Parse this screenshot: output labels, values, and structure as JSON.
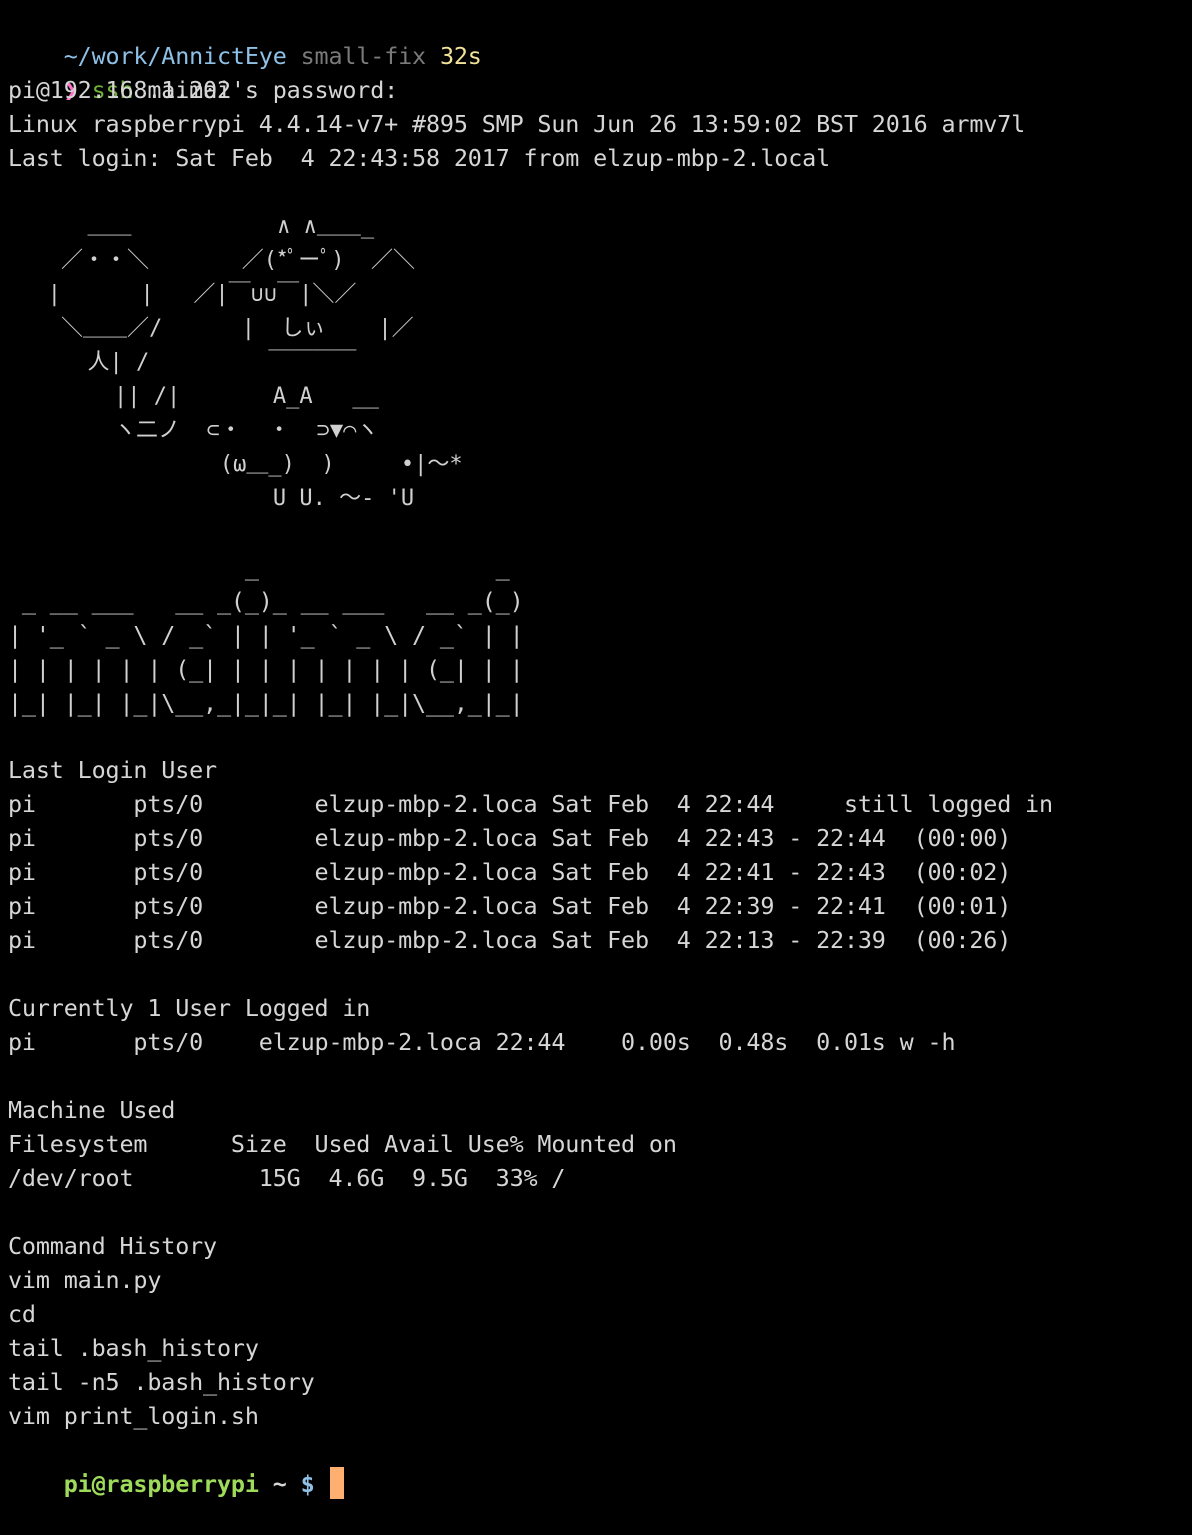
{
  "prompt_header": {
    "path": "~/work/AnnictEye",
    "branch": "small-fix",
    "duration": "32s"
  },
  "command": {
    "arrow": "❯",
    "program": "ssh",
    "argument": "maimai"
  },
  "ssh_output": {
    "password_prompt": "pi@192.168.1.202's password:",
    "uname": "Linux raspberrypi 4.4.14-v7+ #895 SMP Sun Jun 26 13:59:02 BST 2016 armv7l",
    "last_login": "Last login: Sat Feb  4 22:43:58 2017 from elzup-mbp-2.local"
  },
  "kaomoji_art": [
    "      ＿＿           ∧ ∧＿＿_",
    "    ／・・＼       ／(*ﾟーﾟ)  ／＼",
    "   |      |   ／|￣∪∪￣|＼／",
    "    ＼＿＿／/      |  しぃ    |／",
    "      人| /         ￣￣￣￣",
    "        || /|       A_A   __",
    "        ヽ二ノ  ⊂・  ・  ⊃▼⌒ヽ",
    "                (ω＿_)  )     •|～*",
    "                    U U. ～- 'U"
  ],
  "banner_art": [
    "                 _                 _",
    " _ __ ___   __ _(_)_ __ ___   __ _(_)",
    "| '_ ` _ \\ / _` | | '_ ` _ \\ / _` | |",
    "| | | | | | (_| | | | | | | | (_| | |",
    "|_| |_| |_|\\__,_|_|_| |_| |_|\\__,_|_|"
  ],
  "last_login_section": {
    "title": "Last Login User",
    "rows": [
      {
        "user": "pi",
        "tty": "pts/0",
        "host": "elzup-mbp-2.loca",
        "date": "Sat Feb  4",
        "time": "22:44  ",
        "status": " still logged in"
      },
      {
        "user": "pi",
        "tty": "pts/0",
        "host": "elzup-mbp-2.loca",
        "date": "Sat Feb  4",
        "time": "22:43 - 22:44",
        "status": "(00:00)"
      },
      {
        "user": "pi",
        "tty": "pts/0",
        "host": "elzup-mbp-2.loca",
        "date": "Sat Feb  4",
        "time": "22:41 - 22:43",
        "status": "(00:02)"
      },
      {
        "user": "pi",
        "tty": "pts/0",
        "host": "elzup-mbp-2.loca",
        "date": "Sat Feb  4",
        "time": "22:39 - 22:41",
        "status": "(00:01)"
      },
      {
        "user": "pi",
        "tty": "pts/0",
        "host": "elzup-mbp-2.loca",
        "date": "Sat Feb  4",
        "time": "22:13 - 22:39",
        "status": "(00:26)"
      }
    ]
  },
  "current_users_section": {
    "title": "Currently 1 User Logged in",
    "rows": [
      {
        "user": "pi",
        "tty": "pts/0",
        "from": "elzup-mbp-2.loca",
        "login": "22:44",
        "idle": "0.00s",
        "jcpu": "0.48s",
        "pcpu": "0.01s",
        "what": "w -h"
      }
    ]
  },
  "machine_section": {
    "title": "Machine Used",
    "headers": [
      "Filesystem",
      "Size",
      "Used",
      "Avail",
      "Use%",
      "Mounted on"
    ],
    "rows": [
      {
        "filesystem": "/dev/root",
        "size": "15G",
        "used": "4.6G",
        "avail": "9.5G",
        "use_pct": "33%",
        "mounted": "/"
      }
    ]
  },
  "history_section": {
    "title": "Command History",
    "commands": [
      "vim main.py",
      "cd",
      "tail .bash_history",
      "tail -n5 .bash_history",
      "vim print_login.sh"
    ]
  },
  "shell_prompt": {
    "user_host": "pi@raspberrypi",
    "cwd": "~",
    "symbol": "$"
  },
  "colors": {
    "background": "#000000",
    "foreground": "#d6d6d6",
    "path": "#8fc1e6",
    "branch": "#7a7a7a",
    "duration": "#f2e29a",
    "prompt_arrow": "#ff6ec7",
    "command": "#6fb03a",
    "ps1_user": "#9fdb5a",
    "cursor": "#ffb070"
  }
}
